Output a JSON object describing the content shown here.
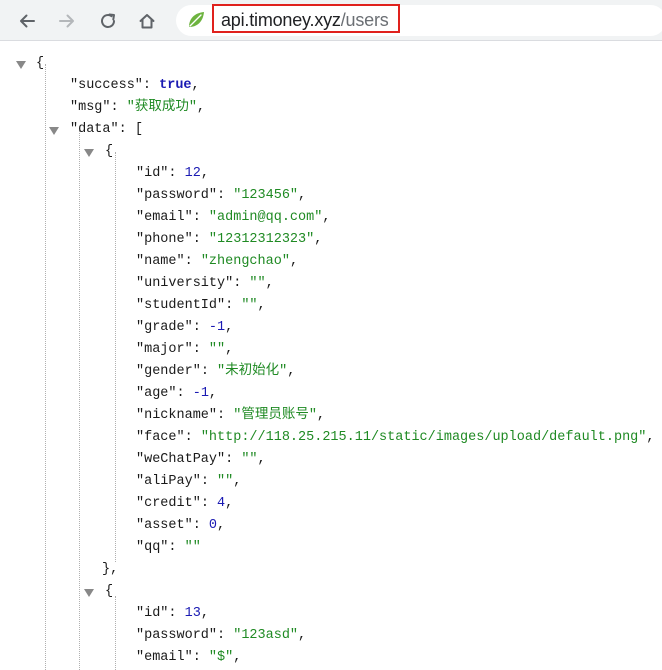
{
  "browser": {
    "url_host": "api.timoney.xyz",
    "url_path": "/users"
  },
  "json": {
    "open_brace": "{",
    "success_key": "\"success\"",
    "success_val": "true",
    "msg_key": "\"msg\"",
    "msg_val": "\"获取成功\"",
    "data_key": "\"data\"",
    "data_open": "[",
    "user1": {
      "open": "{",
      "id_key": "\"id\"",
      "id_val": "12",
      "password_key": "\"password\"",
      "password_val": "\"123456\"",
      "email_key": "\"email\"",
      "email_val": "\"admin@qq.com\"",
      "phone_key": "\"phone\"",
      "phone_val": "\"12312312323\"",
      "name_key": "\"name\"",
      "name_val": "\"zhengchao\"",
      "university_key": "\"university\"",
      "university_val": "\"\"",
      "studentId_key": "\"studentId\"",
      "studentId_val": "\"\"",
      "grade_key": "\"grade\"",
      "grade_val": "-1",
      "major_key": "\"major\"",
      "major_val": "\"\"",
      "gender_key": "\"gender\"",
      "gender_val": "\"未初始化\"",
      "age_key": "\"age\"",
      "age_val": "-1",
      "nickname_key": "\"nickname\"",
      "nickname_val": "\"管理员账号\"",
      "face_key": "\"face\"",
      "face_val": "\"http://118.25.215.11/static/images/upload/default.png\"",
      "weChatPay_key": "\"weChatPay\"",
      "weChatPay_val": "\"\"",
      "aliPay_key": "\"aliPay\"",
      "aliPay_val": "\"\"",
      "credit_key": "\"credit\"",
      "credit_val": "4",
      "asset_key": "\"asset\"",
      "asset_val": "0",
      "qq_key": "\"qq\"",
      "qq_val": "\"\"",
      "close": "},"
    },
    "user2": {
      "open": "{",
      "id_key": "\"id\"",
      "id_val": "13",
      "password_key": "\"password\"",
      "password_val": "\"123asd\"",
      "email_key": "\"email\"",
      "email_val": "\"$\""
    }
  },
  "icons": {
    "back": "back-arrow-icon",
    "forward": "forward-arrow-icon",
    "reload": "reload-icon",
    "home": "home-icon",
    "site": "leaf-icon"
  }
}
